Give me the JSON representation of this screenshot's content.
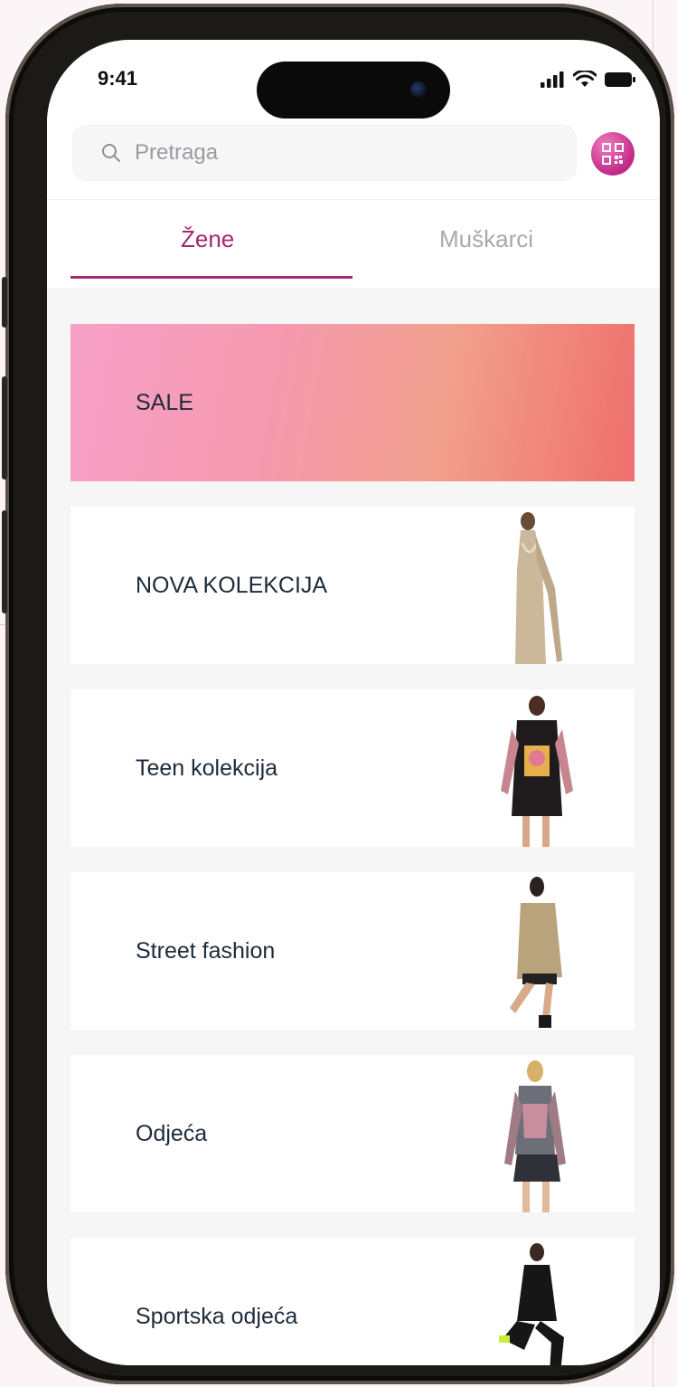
{
  "status_bar": {
    "time": "9:41"
  },
  "search": {
    "placeholder": "Pretraga"
  },
  "tabs": [
    {
      "label": "Žene",
      "active": true
    },
    {
      "label": "Muškarci",
      "active": false
    }
  ],
  "categories": [
    {
      "label": "SALE"
    },
    {
      "label": "NOVA KOLEKCIJA"
    },
    {
      "label": "Teen kolekcija"
    },
    {
      "label": "Street fashion"
    },
    {
      "label": "Odjeća"
    },
    {
      "label": "Sportska odjeća"
    }
  ],
  "colors": {
    "accent": "#a4286e",
    "text": "#1e2a3a",
    "tab_inactive": "#a8a8ae"
  },
  "icons": [
    "search-icon",
    "qr-code-icon",
    "signal-icon",
    "wifi-icon",
    "battery-icon"
  ]
}
